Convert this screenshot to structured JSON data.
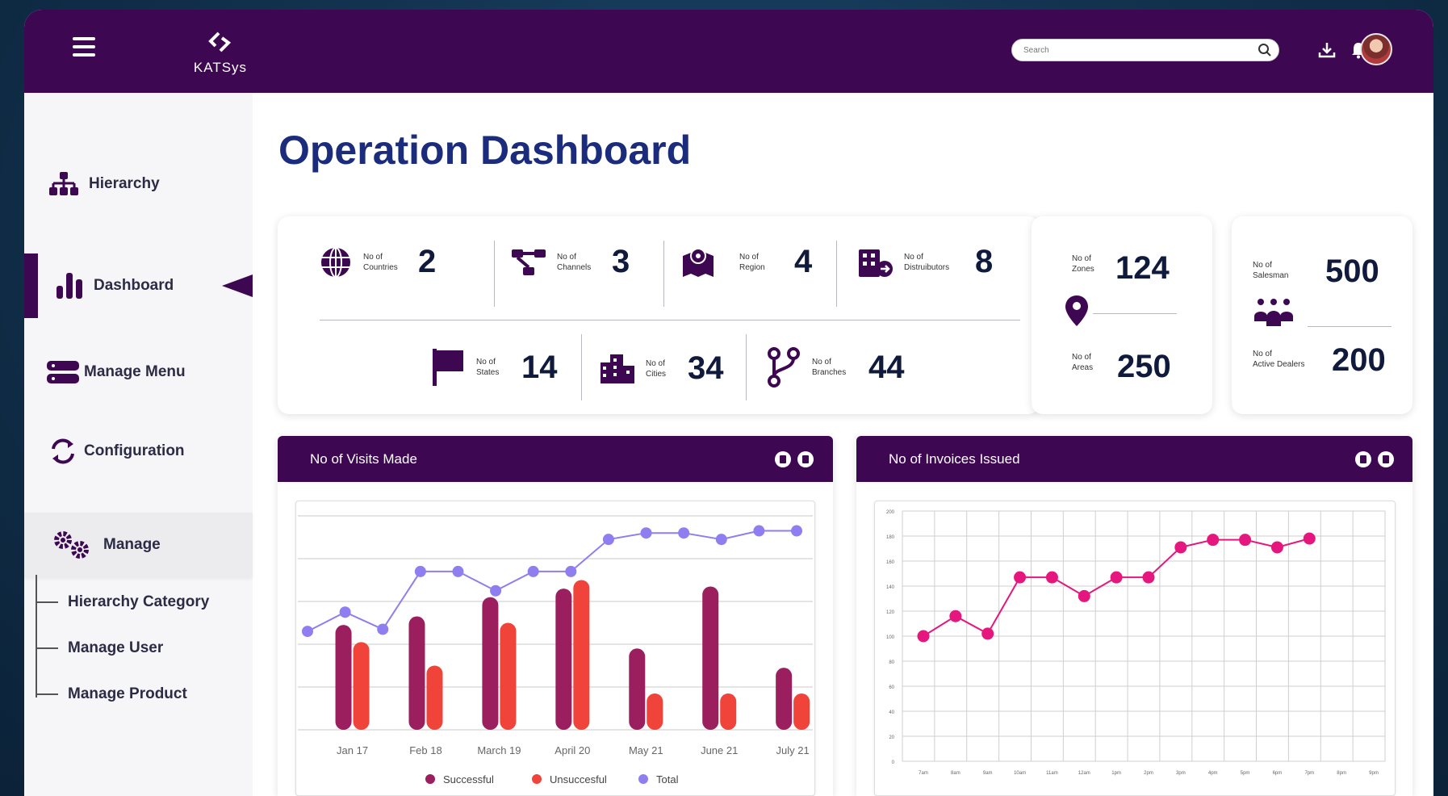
{
  "app": {
    "logo_text": "KATSys",
    "search_placeholder": "Search"
  },
  "sidebar": {
    "items": [
      {
        "label": "Hierarchy",
        "icon": "hierarchy-icon"
      },
      {
        "label": "Dashboard",
        "icon": "bar-chart-icon",
        "active": true
      },
      {
        "label": "Manage Menu",
        "icon": "menu-stack-icon"
      },
      {
        "label": "Configuration",
        "icon": "refresh-icon"
      },
      {
        "label": "Manage",
        "icon": "gears-icon",
        "expanded": true
      }
    ],
    "sub_items": [
      {
        "label": "Hierarchy Category"
      },
      {
        "label": "Manage User"
      },
      {
        "label": "Manage Product"
      }
    ]
  },
  "page": {
    "title": "Operation Dashboard"
  },
  "stats": {
    "countries": {
      "label1": "No of",
      "label2": "Countries",
      "value": "2"
    },
    "channels": {
      "label1": "No of",
      "label2": "Channels",
      "value": "3"
    },
    "region": {
      "label1": "No of",
      "label2": "Region",
      "value": "4"
    },
    "distributors": {
      "label1": "No of",
      "label2": "Distruibutors",
      "value": "8"
    },
    "states": {
      "label1": "No of",
      "label2": "States",
      "value": "14"
    },
    "cities": {
      "label1": "No of",
      "label2": "Cities",
      "value": "34"
    },
    "branches": {
      "label1": "No of",
      "label2": "Branches",
      "value": "44"
    },
    "zones": {
      "label1": "No of",
      "label2": "Zones",
      "value": "124"
    },
    "areas": {
      "label1": "No of",
      "label2": "Areas",
      "value": "250"
    },
    "salesman": {
      "label1": "No of",
      "label2": "Salesman",
      "value": "500"
    },
    "dealers": {
      "label1": "No of",
      "label2": "Active Dealers",
      "value": "200"
    }
  },
  "panels": {
    "visits": {
      "title": "No of Visits Made"
    },
    "invoices": {
      "title": "No of Invoices Issued"
    }
  },
  "chart_data": [
    {
      "type": "bar",
      "categories": [
        "Jan 17",
        "Feb 18",
        "March 19",
        "April 20",
        "May 21",
        "June 21",
        "July 21"
      ],
      "series": [
        {
          "name": "Successful",
          "type": "bar",
          "color": "#9b1f5e",
          "values": [
            49,
            53,
            62,
            66,
            38,
            67,
            29
          ]
        },
        {
          "name": "Unsuccesful",
          "type": "bar",
          "color": "#f0433a",
          "values": [
            41,
            30,
            50,
            70,
            17,
            17,
            17
          ]
        },
        {
          "name": "Total",
          "type": "line",
          "color": "#8f7ef0",
          "x": [
            0,
            0.5,
            1,
            1.5,
            2,
            2.5,
            3,
            3.5,
            4,
            4.5,
            5,
            5.5,
            6,
            6.5
          ],
          "values": [
            46,
            55,
            47,
            74,
            74,
            65,
            74,
            74,
            89,
            92,
            92,
            89,
            93,
            93
          ]
        }
      ],
      "ylim": [
        0,
        100
      ],
      "grid": true,
      "legend": "bottom"
    },
    {
      "type": "line",
      "x": [
        "7am",
        "8am",
        "9am",
        "10am",
        "11am",
        "12am",
        "1pm",
        "2pm",
        "3pm",
        "4pm",
        "5pm",
        "6pm",
        "7pm",
        "8pm",
        "9pm"
      ],
      "series": [
        {
          "color": "#e5177e",
          "x_index": [
            0,
            1,
            2,
            3,
            4,
            5,
            6,
            7,
            8,
            9,
            10,
            11,
            12
          ],
          "values": [
            100,
            116,
            102,
            147,
            147,
            132,
            147,
            147,
            171,
            177,
            177,
            171,
            178
          ]
        }
      ],
      "yticks": [
        0,
        20,
        40,
        60,
        80,
        100,
        120,
        140,
        160,
        180,
        200
      ],
      "ylim": [
        0,
        200
      ],
      "grid": true
    }
  ]
}
